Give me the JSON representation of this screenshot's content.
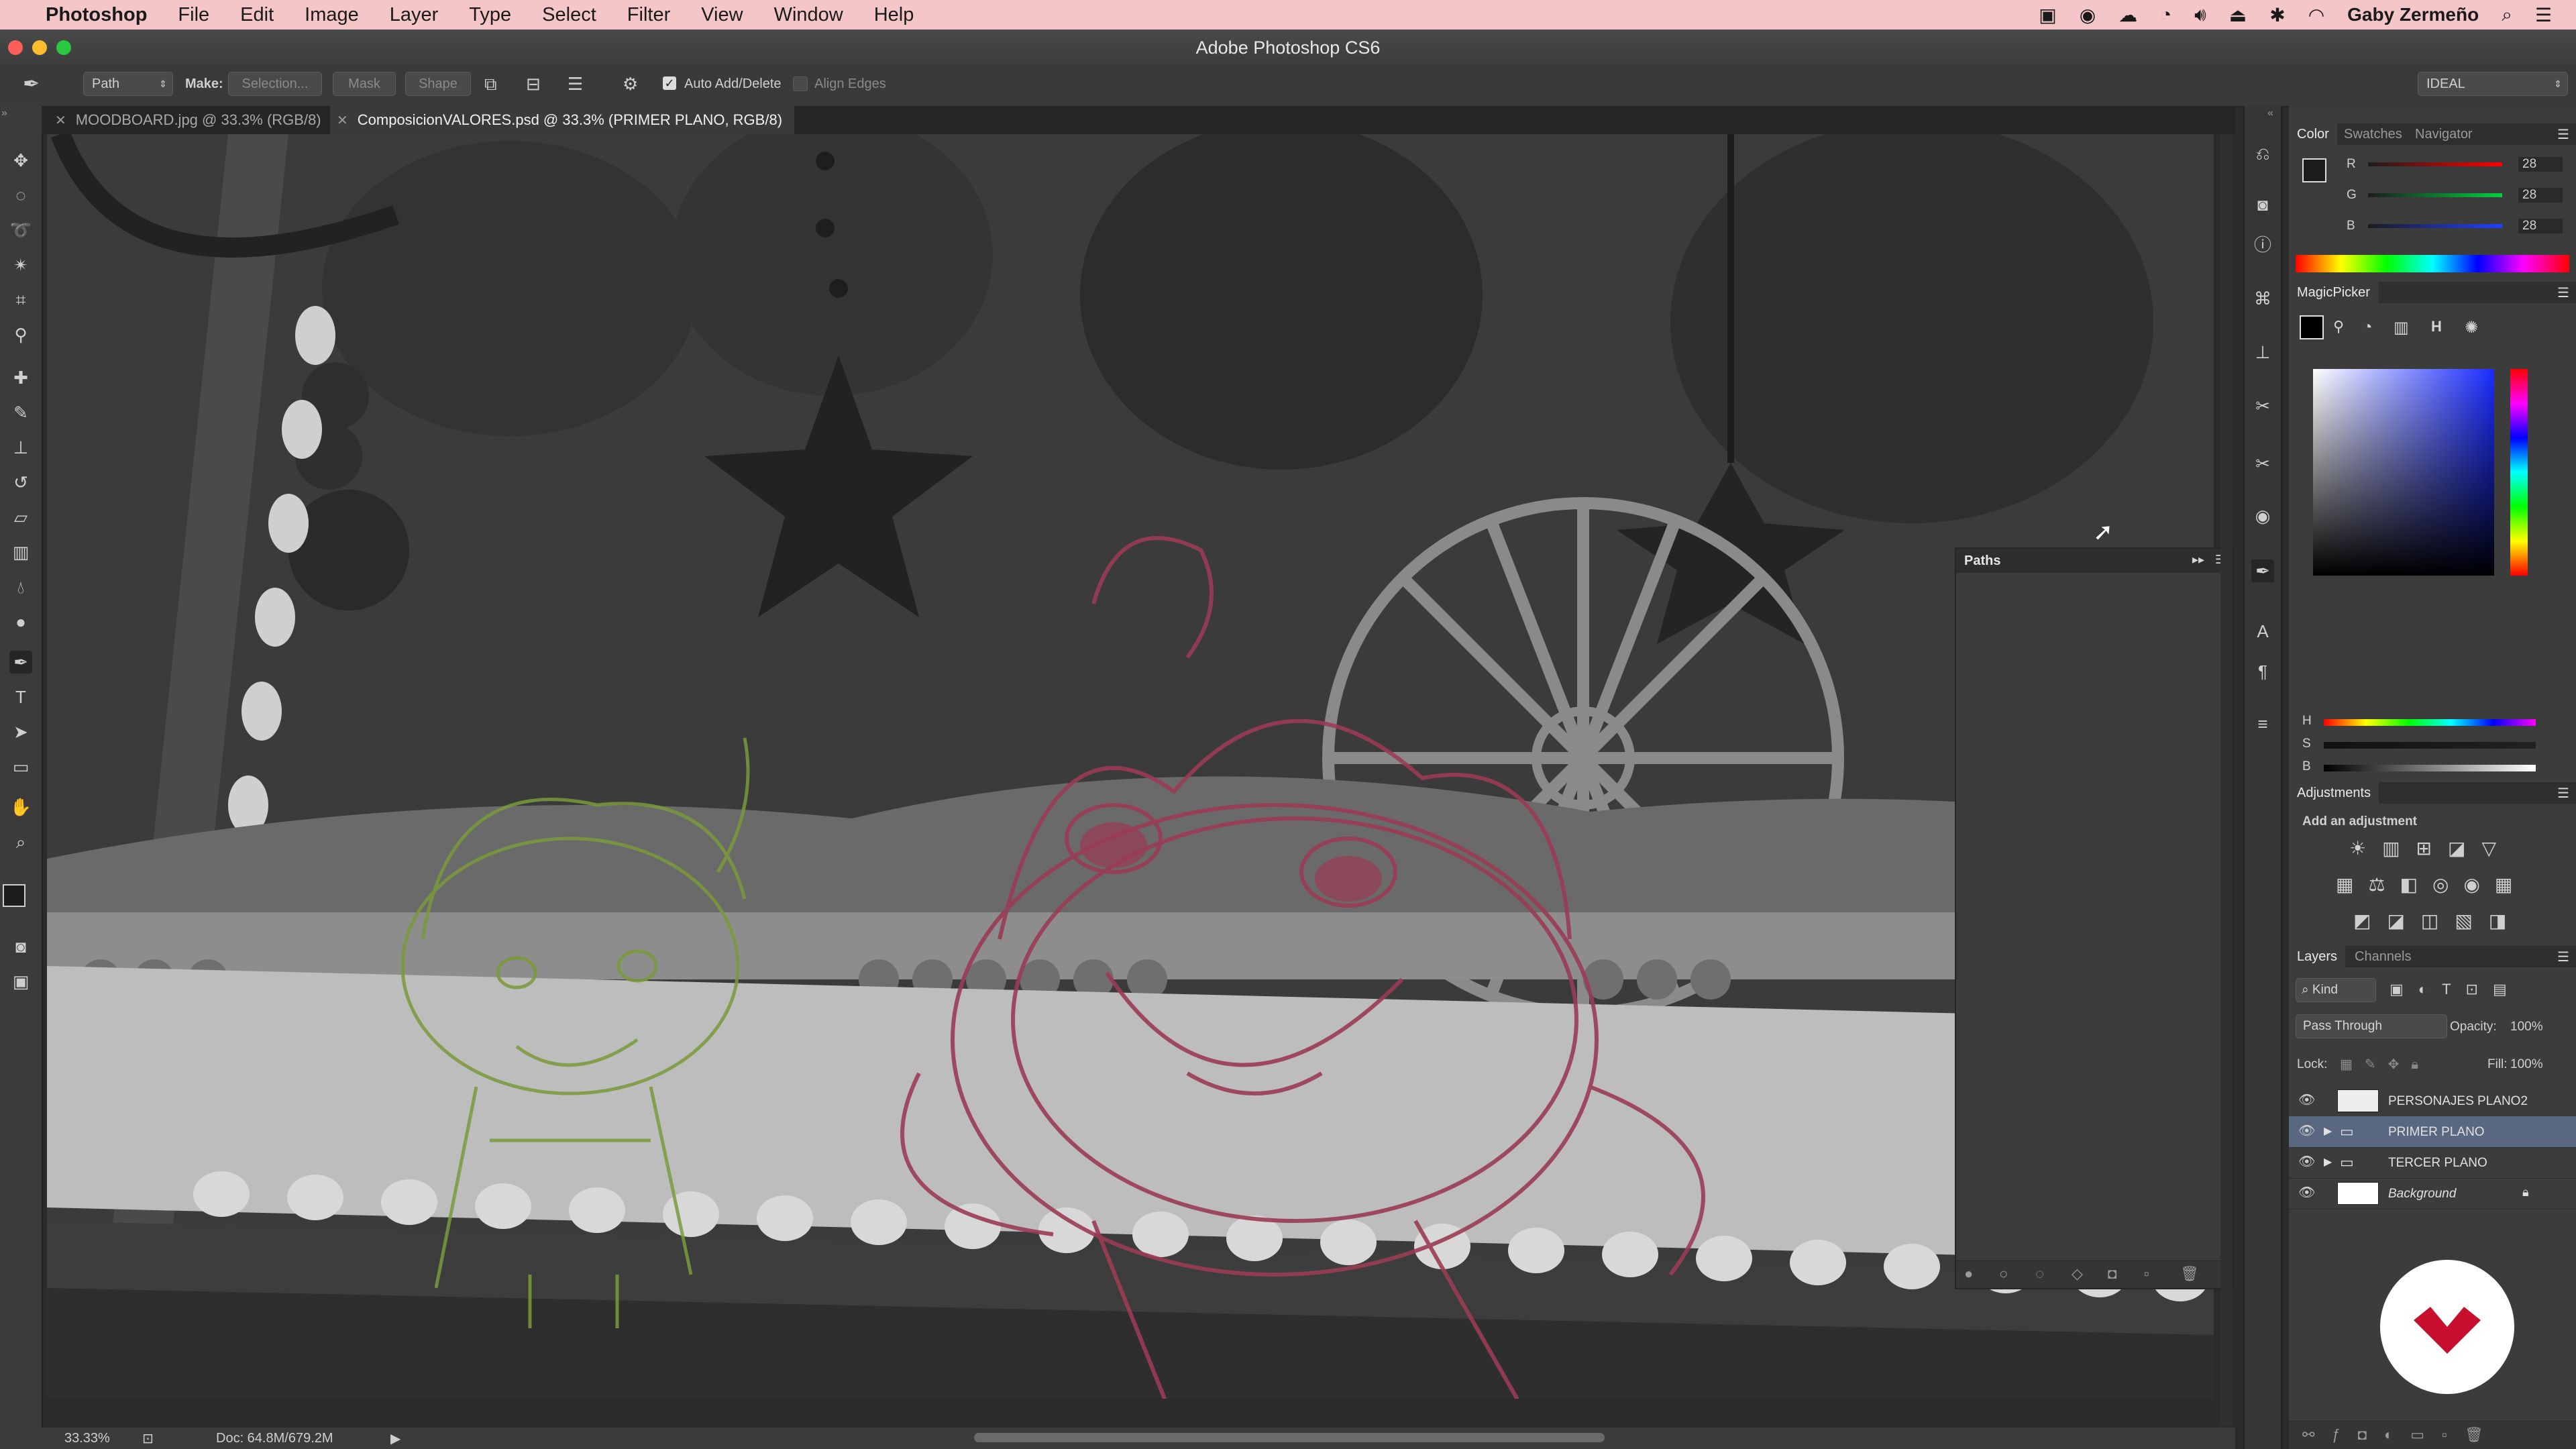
{
  "menubar": {
    "app_name": "Photoshop",
    "items": [
      "File",
      "Edit",
      "Image",
      "Layer",
      "Type",
      "Select",
      "Filter",
      "View",
      "Window",
      "Help"
    ],
    "user_name": "Gaby Zermeño"
  },
  "window": {
    "title": "Adobe Photoshop CS6"
  },
  "options": {
    "tool_mode": "Path",
    "make_label": "Make:",
    "selection_label": "Selection...",
    "mask_label": "Mask",
    "shape_label": "Shape",
    "auto_add_delete_label": "Auto Add/Delete",
    "auto_add_delete_checked": true,
    "align_edges_label": "Align Edges",
    "workspace": "IDEAL"
  },
  "tabs": [
    {
      "label": "MOODBOARD.jpg @ 33.3% (RGB/8)",
      "active": false
    },
    {
      "label": "ComposicionVALORES.psd @ 33.3% (PRIMER PLANO, RGB/8)",
      "active": true
    }
  ],
  "status": {
    "zoom": "33.33%",
    "doc": "Doc: 64.8M/679.2M"
  },
  "paths_panel": {
    "title": "Paths"
  },
  "color_panel": {
    "tabs": [
      "Color",
      "Swatches",
      "Navigator"
    ],
    "channels": [
      {
        "label": "R",
        "value": "28",
        "color": "#e03030"
      },
      {
        "label": "G",
        "value": "28",
        "color": "#30c040"
      },
      {
        "label": "B",
        "value": "28",
        "color": "#3050e0"
      }
    ]
  },
  "magicpicker": {
    "title": "MagicPicker",
    "mode": "H",
    "sliders": [
      "H",
      "S",
      "B"
    ]
  },
  "adjustments": {
    "title": "Adjustments",
    "subtitle": "Add an adjustment"
  },
  "layers_panel": {
    "tabs": [
      "Layers",
      "Channels"
    ],
    "filter": "Kind",
    "blend_mode": "Pass Through",
    "opacity_label": "Opacity:",
    "opacity": "100%",
    "lock_label": "Lock:",
    "fill_label": "Fill:",
    "fill": "100%",
    "layers": [
      {
        "name": "PERSONAJES PLANO2",
        "type": "layer",
        "selected": false
      },
      {
        "name": "PRIMER PLANO",
        "type": "group",
        "selected": true
      },
      {
        "name": "TERCER PLANO",
        "type": "group",
        "selected": false
      },
      {
        "name": "Background",
        "type": "background",
        "selected": false
      }
    ]
  },
  "colors": {
    "menubar": "#f4c6c8",
    "sketch_red": "#9a3c54",
    "sketch_green": "#7a9a3a",
    "logo_red": "#c8102e"
  }
}
